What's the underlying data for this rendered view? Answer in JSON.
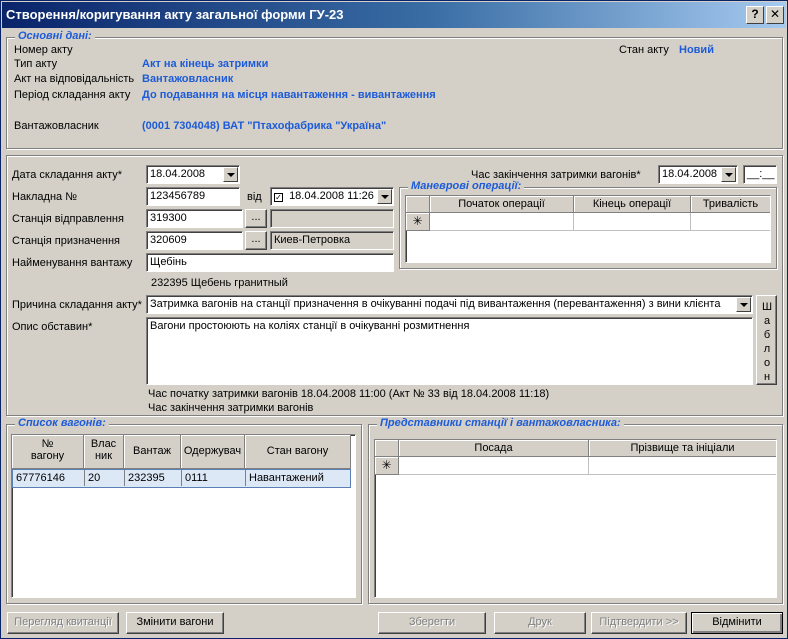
{
  "window": {
    "title": "Створення/коригування акту загальної форми ГУ-23",
    "help_label": "?",
    "close_label": "✕"
  },
  "basic": {
    "legend": "Основні дані:",
    "act_number_label": "Номер акту",
    "act_state_label": "Стан акту",
    "act_state_value": "Новий",
    "act_type_label": "Тип акту",
    "act_type_value": "Акт на кінець затримки",
    "responsibility_label": "Акт на відповідальність",
    "responsibility_value": "Вантажовласник",
    "period_label": "Період складання акту",
    "period_value": "До подавання на місця навантаження - вивантаження",
    "owner_label": "Вантажовласник",
    "owner_value": "(0001 7304048) ВАТ \"Птахофабрика \"Україна\""
  },
  "form": {
    "date_label": "Дата складання акту*",
    "date_value": "18.04.2008",
    "end_delay_label": "Час закінчення затримки вагонів*",
    "end_delay_date": "18.04.2008",
    "end_delay_time": "__:__",
    "waybill_label": "Накладна №",
    "waybill_value": "123456789",
    "from_label": "від",
    "waybill_date": "18.04.2008 11:26",
    "dep_station_label": "Станція відправлення",
    "dep_station_value": "319300",
    "dep_station_name": "",
    "dest_station_label": "Станція призначення",
    "dest_station_value": "320609",
    "dest_station_name": "Киев-Петровка",
    "cargo_label": "Найменування вантажу",
    "cargo_value": "Щебінь",
    "cargo_code_text": "232395 Щебень гранитный",
    "browse_label": "...",
    "reason_label": "Причина складання акту*",
    "reason_value": "Затримка вагонів на станції призначення в очікуванні подачі під вивантаження (перевантаження) з вини клієнта",
    "circ_label": "Опис обставин*",
    "circ_value": "Вагони простоюють на коліях станції в очікуванні розмитнення",
    "template_label": "Шаблон",
    "start_delay_text": "Час початку затримки вагонів 18.04.2008 11:00 (Акт № 33 від 18.04.2008 11:18)",
    "end_delay_text": "Час закінчення затримки вагонів"
  },
  "shunting": {
    "legend": "Маневрові операції:",
    "columns": [
      "Початок операції",
      "Кінець операції",
      "Тривалість"
    ],
    "new_row_marker": "✳"
  },
  "wagons": {
    "legend": "Список вагонів:",
    "columns": [
      "№\nвагону",
      "Влас\nник",
      "Вантаж",
      "Одержувач",
      "Стан вагону"
    ],
    "rows": [
      [
        "67776146",
        "20",
        "232395",
        "0111",
        "Навантажений"
      ]
    ]
  },
  "reps": {
    "legend": "Представники станції і вантажовласника:",
    "columns": [
      "Посада",
      "Прізвище та ініціали"
    ],
    "new_row_marker": "✳"
  },
  "buttons": {
    "receipts": "Перегляд квитанції",
    "change_wagons": "Змінити вагони",
    "save": "Зберегти",
    "print": "Друк",
    "confirm": "Підтвердити >>",
    "cancel": "Відмінити"
  },
  "colors": {
    "accent": "#1d5bd8",
    "title_start": "#0a246a",
    "face": "#d4d0c8",
    "selected_row": "#dde8f7"
  }
}
